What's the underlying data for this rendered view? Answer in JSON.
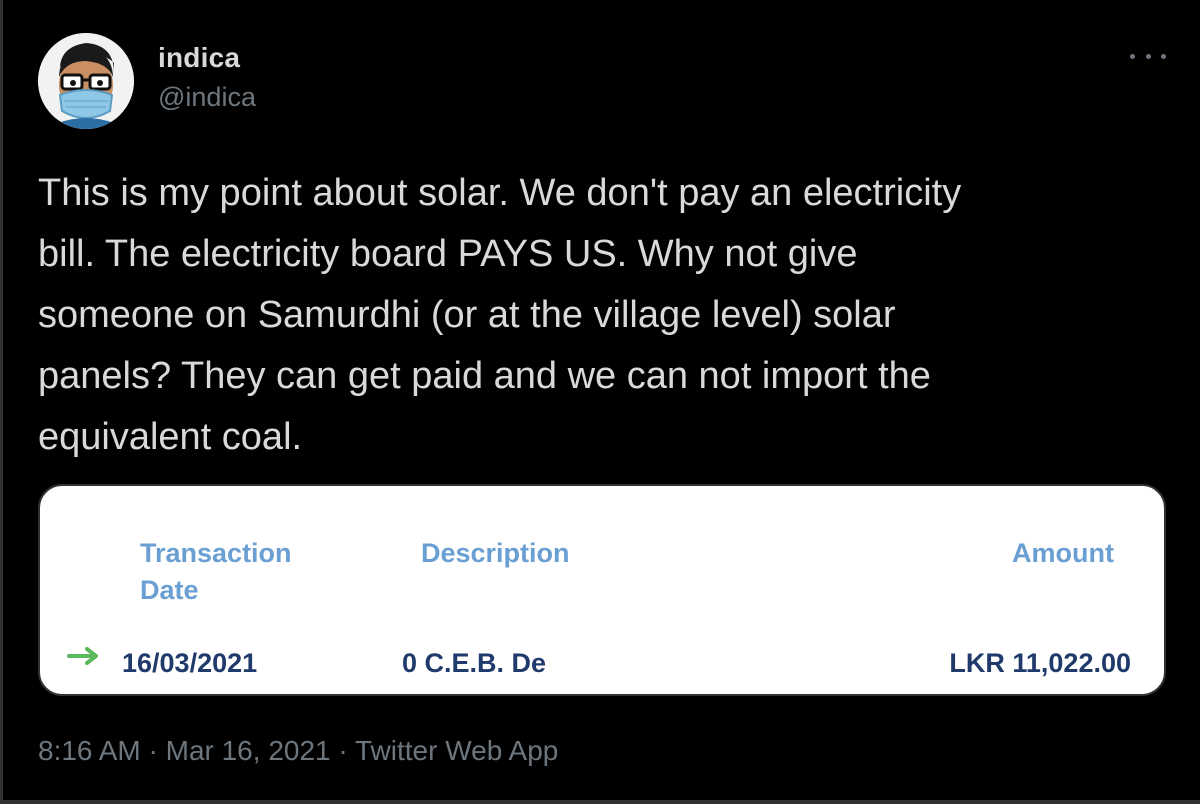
{
  "user": {
    "name": "indica",
    "handle": "@indica"
  },
  "tweet": {
    "text": "This is my point about solar. We don't pay an electricity\nbill. The electricity board PAYS US. Why not give\nsomeone on Samurdhi (or at the village level) solar\npanels? They can get paid and we can not import the\nequivalent coal."
  },
  "card": {
    "headers": {
      "date": "Transaction\nDate",
      "description": "Description",
      "amount": "Amount"
    },
    "row": {
      "date": "16/03/2021",
      "description": "0 C.E.B. De",
      "amount": "LKR 11,022.00",
      "direction_icon": "arrow-right-icon"
    }
  },
  "meta": {
    "text": "8:16 AM · Mar 16, 2021 · Twitter Web App"
  },
  "colors": {
    "background": "#000000",
    "text": "#d9d9d9",
    "muted": "#6e767d",
    "header_blue": "#6a9fd3",
    "value_navy": "#1f3a6b",
    "arrow_green": "#5cb85c"
  }
}
